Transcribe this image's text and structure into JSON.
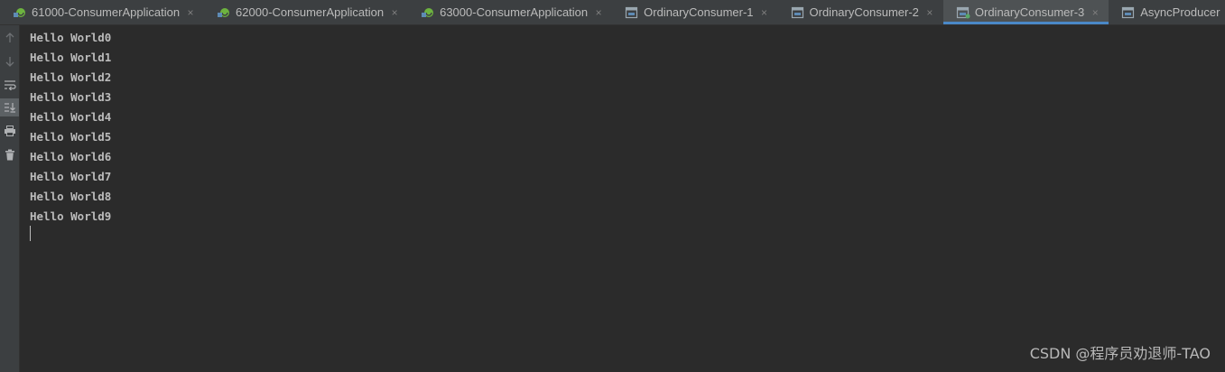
{
  "tabs": [
    {
      "label": "61000-ConsumerApplication",
      "icon": "spring-boot-icon",
      "active": false
    },
    {
      "label": "62000-ConsumerApplication",
      "icon": "spring-boot-icon",
      "active": false
    },
    {
      "label": "63000-ConsumerApplication",
      "icon": "spring-boot-icon",
      "active": false
    },
    {
      "label": "OrdinaryConsumer-1",
      "icon": "application-window-icon",
      "active": false
    },
    {
      "label": "OrdinaryConsumer-2",
      "icon": "application-window-icon",
      "active": false
    },
    {
      "label": "OrdinaryConsumer-3",
      "icon": "application-window-icon",
      "active": true
    },
    {
      "label": "AsyncProducer",
      "icon": "application-window-icon",
      "active": false
    }
  ],
  "close_glyph": "×",
  "toolbar": {
    "icons": [
      "up-arrow-icon",
      "down-arrow-icon",
      "soft-wrap-icon",
      "scroll-to-end-icon",
      "print-icon",
      "trash-icon"
    ]
  },
  "console": {
    "lines": [
      "Hello World0",
      "Hello World1",
      "Hello World2",
      "Hello World3",
      "Hello World4",
      "Hello World5",
      "Hello World6",
      "Hello World7",
      "Hello World8",
      "Hello World9"
    ]
  },
  "watermark": "CSDN @程序员劝退师-TAO",
  "colors": {
    "background": "#2b2b2b",
    "panel": "#3c3f41",
    "text": "#bbbbbb",
    "active_tab_underline": "#4a88c7",
    "spring_green": "#6db33f"
  }
}
